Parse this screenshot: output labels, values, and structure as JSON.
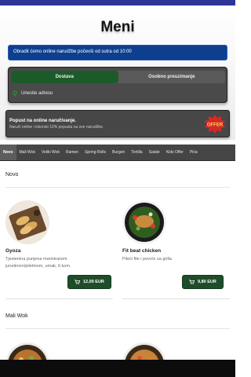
{
  "page": {
    "title": "Meni"
  },
  "notice": {
    "text": "Obradit ćemo online narudžbe počevši od sutra od 10:00"
  },
  "order_mode": {
    "options": [
      "Dostava",
      "Osobno preuzimanje"
    ],
    "selected": "Dostava"
  },
  "address": {
    "placeholder": "Unesite adresu"
  },
  "promo": {
    "title": "Popust na online naručivanje.",
    "subtitle": "Naruči online i iskoristi 10% popusta na sve narudžbe."
  },
  "categories": [
    "Novo",
    "Mali Wok",
    "Veliki Wok",
    "Ramen",
    "Spring Rolls",
    "Burgeri",
    "Tortilla",
    "Salate",
    "Kids Offer",
    "Pića"
  ],
  "active_category": "Novo",
  "sections": [
    {
      "title": "Novo",
      "items": [
        {
          "name": "Gyoza",
          "description": "Tjestenina punjena mariniranom junetinom/piletinom, umak, 6 kom.",
          "price": "12,00 EUR"
        },
        {
          "name": "Fit beat chicken",
          "description": "Pileći file i povrće sa grilla",
          "price": "9,80 EUR"
        }
      ]
    },
    {
      "title": "Mali Wok",
      "items": []
    }
  ],
  "colors": {
    "accent": "#1f4d2a",
    "header_band": "#2c3795",
    "notice_bg": "#0e3f8f",
    "panel_bg": "#4a4a4a"
  },
  "icons": {
    "address": "location-pin-icon",
    "cart": "cart-icon",
    "offer": "offer-badge-icon"
  }
}
